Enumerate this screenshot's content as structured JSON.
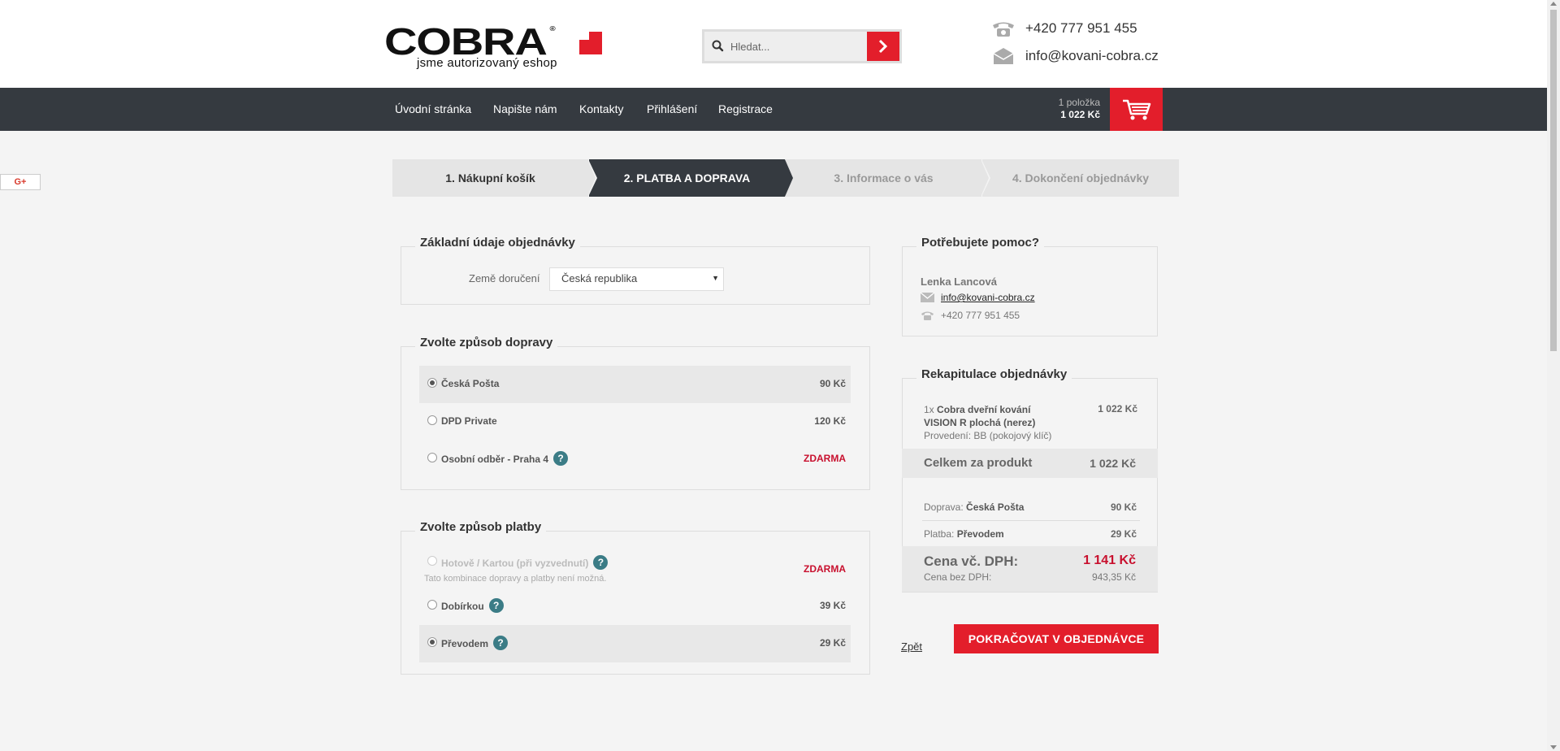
{
  "header": {
    "logo_text": "COBRA",
    "logo_reg": "®",
    "logo_tagline": "jsme autorizovaný eshop",
    "search_placeholder": "Hledat...",
    "phone": "+420 777 951 455",
    "email": "info@kovani-cobra.cz"
  },
  "nav": {
    "items": [
      "Úvodní stránka",
      "Napište nám",
      "Kontakty",
      "Přihlášení",
      "Registrace"
    ],
    "cart_count": "1 položka",
    "cart_total": "1 022 Kč"
  },
  "social": {
    "gplus_label": "G+"
  },
  "steps": [
    {
      "label": "1. Nákupní košík",
      "state": "done"
    },
    {
      "label": "2. PLATBA A DOPRAVA",
      "state": "active"
    },
    {
      "label": "3. Informace o vás",
      "state": "todo"
    },
    {
      "label": "4. Dokončení objednávky",
      "state": "todo"
    }
  ],
  "basic": {
    "title": "Základní údaje objednávky",
    "country_label": "Země doručení",
    "country_value": "Česká republika"
  },
  "shipping": {
    "title": "Zvolte způsob dopravy",
    "options": [
      {
        "label": "Česká Pošta",
        "price": "90 Kč",
        "selected": true,
        "help": false
      },
      {
        "label": "DPD Private",
        "price": "120 Kč",
        "selected": false,
        "help": false
      },
      {
        "label": "Osobní odběr - Praha 4",
        "price": "ZDARMA",
        "selected": false,
        "help": true
      }
    ]
  },
  "payment": {
    "title": "Zvolte způsob platby",
    "options": [
      {
        "label": "Hotově / Kartou (při vyzvednutí)",
        "price": "ZDARMA",
        "selected": false,
        "disabled": true,
        "note": "Tato kombinace dopravy a platby není možná."
      },
      {
        "label": "Dobírkou",
        "price": "39 Kč",
        "selected": false,
        "disabled": false
      },
      {
        "label": "Převodem",
        "price": "29 Kč",
        "selected": true,
        "disabled": false
      }
    ],
    "help_glyph": "?"
  },
  "help_box": {
    "title": "Potřebujete pomoc?",
    "name": "Lenka Lancová",
    "email": "info@kovani-cobra.cz",
    "phone": "+420 777 951 455"
  },
  "recap": {
    "title": "Rekapitulace objednávky",
    "product_qty": "1x",
    "product_name": "Cobra dveřní kování VISION R plochá (nerez)",
    "product_variant": "Provedení: BB (pokojový klíč)",
    "product_price": "1 022 Kč",
    "subtotal_label": "Celkem za produkt",
    "subtotal_value": "1 022 Kč",
    "shipping_label": "Doprava:",
    "shipping_method": "Česká Pošta",
    "shipping_price": "90 Kč",
    "payment_label": "Platba:",
    "payment_method": "Převodem",
    "payment_price": "29 Kč",
    "total_label": "Cena vč. DPH:",
    "total_value": "1 141 Kč",
    "total_net_label": "Cena bez DPH:",
    "total_net_value": "943,35 Kč"
  },
  "actions": {
    "back_label": "Zpět",
    "continue_label": "POKRAČOVAT V OBJEDNÁVCE"
  },
  "colors": {
    "accent": "#e31e2b",
    "dark": "#353a40",
    "help_icon": "#3b7c86",
    "free_price": "#c8102e"
  }
}
